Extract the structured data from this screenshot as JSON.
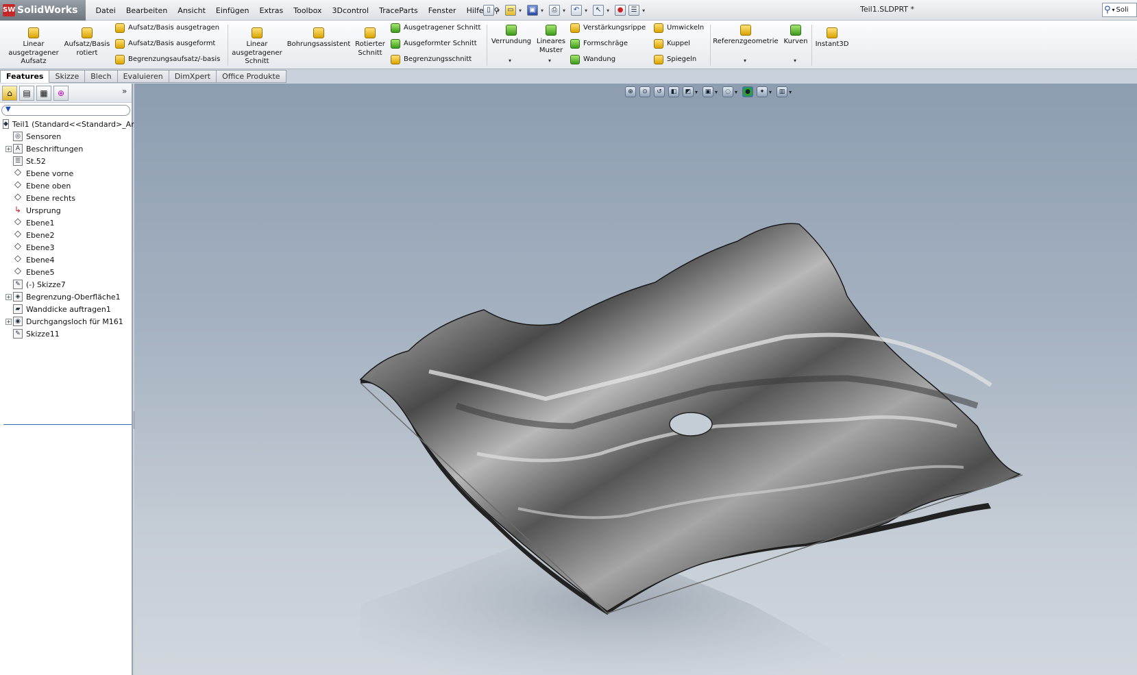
{
  "app": {
    "name": "SolidWorks",
    "logo_badge": "SW",
    "document_title": "Teil1.SLDPRT *",
    "search_text": "Soli"
  },
  "menu": [
    "Datei",
    "Bearbeiten",
    "Ansicht",
    "Einfügen",
    "Extras",
    "Toolbox",
    "3Dcontrol",
    "TraceParts",
    "Fenster",
    "Hilfe"
  ],
  "ribbon": {
    "linear_aufsatz": "Linear ausgetragener Aufsatz",
    "aufsatz_rotiert": "Aufsatz/Basis rotiert",
    "aufsatz_ausgetragen": "Aufsatz/Basis ausgetragen",
    "aufsatz_ausgeformt": "Aufsatz/Basis ausgeformt",
    "begrenzungsaufsatz": "Begrenzungsaufsatz/-basis",
    "linear_schnitt": "Linear ausgetragener Schnitt",
    "bohrungsassistent": "Bohrungsassistent",
    "rotierter_schnitt": "Rotierter Schnitt",
    "ausgetragener_schnitt": "Ausgetragener Schnitt",
    "ausgeformter_schnitt": "Ausgeformter Schnitt",
    "begrenzungsschnitt": "Begrenzungsschnitt",
    "verrundung": "Verrundung",
    "lineares_muster": "Lineares Muster",
    "verstaerkungsrippe": "Verstärkungsrippe",
    "formschraege": "Formschräge",
    "wandung": "Wandung",
    "umwickeln": "Umwickeln",
    "kuppel": "Kuppel",
    "spiegeln": "Spiegeln",
    "referenzgeometrie": "Referenzgeometrie",
    "kurven": "Kurven",
    "instant3d": "Instant3D"
  },
  "tabs": [
    "Features",
    "Skizze",
    "Blech",
    "Evaluieren",
    "DimXpert",
    "Office Produkte"
  ],
  "tree": [
    {
      "label": "Teil1  (Standard<<Standard>_Ar",
      "icon": "part-icon",
      "expand": "",
      "level": 0
    },
    {
      "label": "Sensoren",
      "icon": "sensor-icon",
      "expand": "",
      "level": 1
    },
    {
      "label": "Beschriftungen",
      "icon": "annotation-icon",
      "expand": "+",
      "level": 1
    },
    {
      "label": "St.52",
      "icon": "material-icon",
      "expand": "",
      "level": 1
    },
    {
      "label": "Ebene vorne",
      "icon": "plane-icon",
      "expand": "",
      "level": 1
    },
    {
      "label": "Ebene oben",
      "icon": "plane-icon",
      "expand": "",
      "level": 1
    },
    {
      "label": "Ebene rechts",
      "icon": "plane-icon",
      "expand": "",
      "level": 1
    },
    {
      "label": "Ursprung",
      "icon": "origin-icon",
      "expand": "",
      "level": 1
    },
    {
      "label": "Ebene1",
      "icon": "plane-icon",
      "expand": "",
      "level": 1
    },
    {
      "label": "Ebene2",
      "icon": "plane-icon",
      "expand": "",
      "level": 1
    },
    {
      "label": "Ebene3",
      "icon": "plane-icon",
      "expand": "",
      "level": 1
    },
    {
      "label": "Ebene4",
      "icon": "plane-icon",
      "expand": "",
      "level": 1
    },
    {
      "label": "Ebene5",
      "icon": "plane-icon",
      "expand": "",
      "level": 1
    },
    {
      "label": "(-) Skizze7",
      "icon": "sketch-icon",
      "expand": "",
      "level": 1
    },
    {
      "label": "Begrenzung-Oberfläche1",
      "icon": "surface-icon",
      "expand": "+",
      "level": 1
    },
    {
      "label": "Wanddicke auftragen1",
      "icon": "thicken-icon",
      "expand": "",
      "level": 1
    },
    {
      "label": "Durchgangsloch für M161",
      "icon": "hole-icon",
      "expand": "+",
      "level": 1
    },
    {
      "label": "Skizze11",
      "icon": "sketch-icon",
      "expand": "",
      "level": 1
    }
  ]
}
